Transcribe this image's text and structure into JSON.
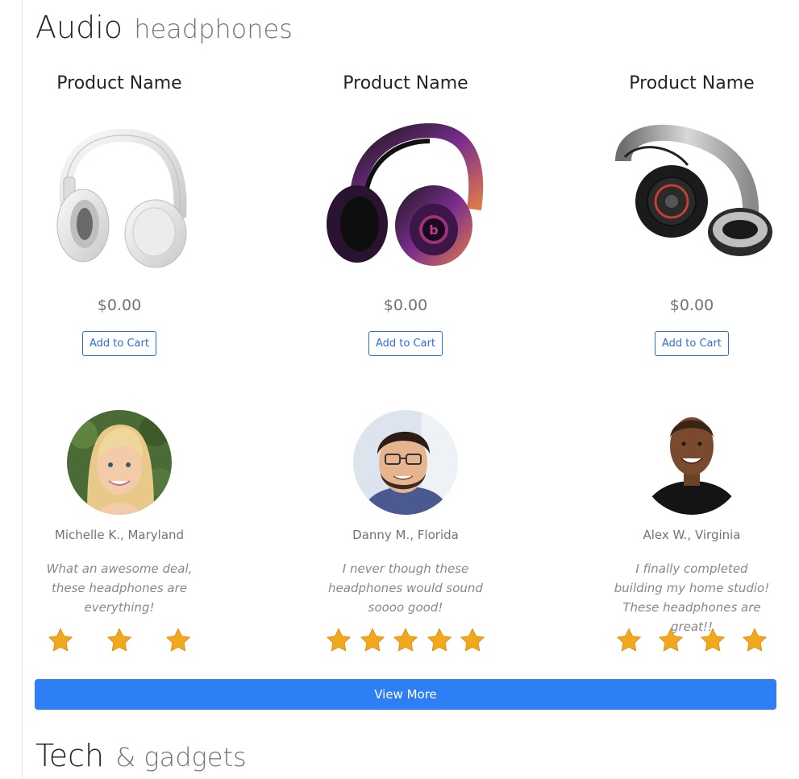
{
  "sections": [
    {
      "title": "Audio",
      "subtitle": "headphones"
    },
    {
      "title": "Tech",
      "subtitle": "& gadgets"
    }
  ],
  "products": [
    {
      "name": "Product Name",
      "price": "$0.00",
      "button_label": "Add to Cart",
      "image": "white-headphones"
    },
    {
      "name": "Product Name",
      "price": "$0.00",
      "button_label": "Add to Cart",
      "image": "beats-purple-headphones"
    },
    {
      "name": "Product Name",
      "price": "$0.00",
      "button_label": "Add to Cart",
      "image": "black-silver-headphones"
    }
  ],
  "reviews": [
    {
      "reviewer": "Michelle K., Maryland",
      "quote": "What an awesome deal, these headphones are everything!",
      "stars": 3
    },
    {
      "reviewer": "Danny M., Florida",
      "quote": "I never though these headphones would sound soooo good!",
      "stars": 5
    },
    {
      "reviewer": "Alex W., Virginia",
      "quote": "I finally completed building my home studio! These headphones are great!!",
      "stars": 4
    }
  ],
  "view_more_label": "View More",
  "colors": {
    "accent": "#2e7ff6",
    "outline_button": "#2d6ed6",
    "star": "#f2a81d",
    "muted_text": "#6c757d"
  }
}
